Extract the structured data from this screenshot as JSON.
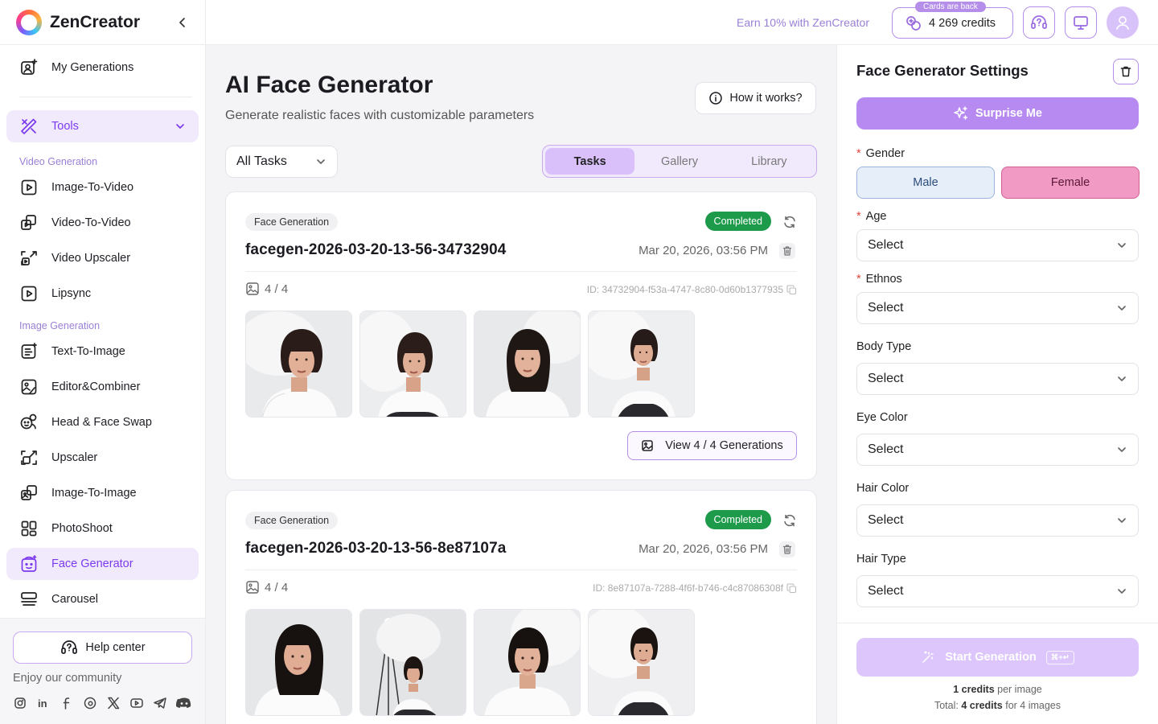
{
  "app": {
    "brand": "ZenCreator"
  },
  "sidebar": {
    "my_generations": "My Generations",
    "tools": "Tools",
    "video_section": "Video Generation",
    "image_section": "Image Generation",
    "video_items": [
      {
        "label": "Image-To-Video",
        "icon": "image-to-video-icon"
      },
      {
        "label": "Video-To-Video",
        "icon": "video-to-video-icon"
      },
      {
        "label": "Video Upscaler",
        "icon": "video-upscaler-icon"
      },
      {
        "label": "Lipsync",
        "icon": "lipsync-icon"
      }
    ],
    "image_items": [
      {
        "label": "Text-To-Image",
        "icon": "text-to-image-icon"
      },
      {
        "label": "Editor&Combiner",
        "icon": "editor-icon"
      },
      {
        "label": "Head & Face Swap",
        "icon": "face-swap-icon"
      },
      {
        "label": "Upscaler",
        "icon": "upscaler-icon"
      },
      {
        "label": "Image-To-Image",
        "icon": "image-to-image-icon"
      },
      {
        "label": "PhotoShoot",
        "icon": "photoshoot-icon"
      },
      {
        "label": "Face Generator",
        "icon": "face-generator-icon",
        "active": true
      },
      {
        "label": "Carousel",
        "icon": "carousel-icon"
      }
    ],
    "help_center": "Help center",
    "community": "Enjoy our community",
    "socials": [
      "instagram-icon",
      "linkedin-icon",
      "facebook-icon",
      "threads-icon",
      "x-icon",
      "youtube-icon",
      "telegram-icon",
      "discord-icon"
    ]
  },
  "topbar": {
    "earn": "Earn 10% with ZenCreator",
    "cards_badge": "Cards are back",
    "credits": "4 269 credits"
  },
  "main": {
    "title": "AI Face Generator",
    "subtitle": "Generate realistic faces with customizable parameters",
    "how_it_works": "How it works?",
    "filter": "All Tasks",
    "tabs": [
      {
        "label": "Tasks",
        "active": true
      },
      {
        "label": "Gallery",
        "active": false
      },
      {
        "label": "Library",
        "active": false
      }
    ],
    "tasks": [
      {
        "tag": "Face Generation",
        "status": "Completed",
        "name": "facegen-2026-03-20-13-56-34732904",
        "date": "Mar 20, 2026, 03:56 PM",
        "count": "4 / 4",
        "id": "ID: 34732904-f53a-4747-8c80-0d60b1377935",
        "view": "View 4 / 4 Generations"
      },
      {
        "tag": "Face Generation",
        "status": "Completed",
        "name": "facegen-2026-03-20-13-56-8e87107a",
        "date": "Mar 20, 2026, 03:56 PM",
        "count": "4 / 4",
        "id": "ID: 8e87107a-7288-4f6f-b746-c4c87086308f"
      }
    ]
  },
  "panel": {
    "title": "Face Generator Settings",
    "surprise": "Surprise Me",
    "gender_label": "Gender",
    "male": "Male",
    "female": "Female",
    "age_label": "Age",
    "ethnos_label": "Ethnos",
    "body_label": "Body Type",
    "eye_label": "Eye Color",
    "hair_color_label": "Hair Color",
    "hair_type_label": "Hair Type",
    "select_value": "Select",
    "start": "Start Generation",
    "shortcut": "⌘+↵",
    "cost_per_image_value": "1 credits",
    "cost_per_image_suffix": " per image",
    "total_prefix": "Total: ",
    "total_value": "4 credits",
    "total_suffix": " for 4 images"
  },
  "colors": {
    "accent": "#9a6ae0",
    "active_bg": "#f1eafd",
    "completed": "#1e9a4b",
    "female": "#f19ac4",
    "male": "#e6eef9"
  }
}
